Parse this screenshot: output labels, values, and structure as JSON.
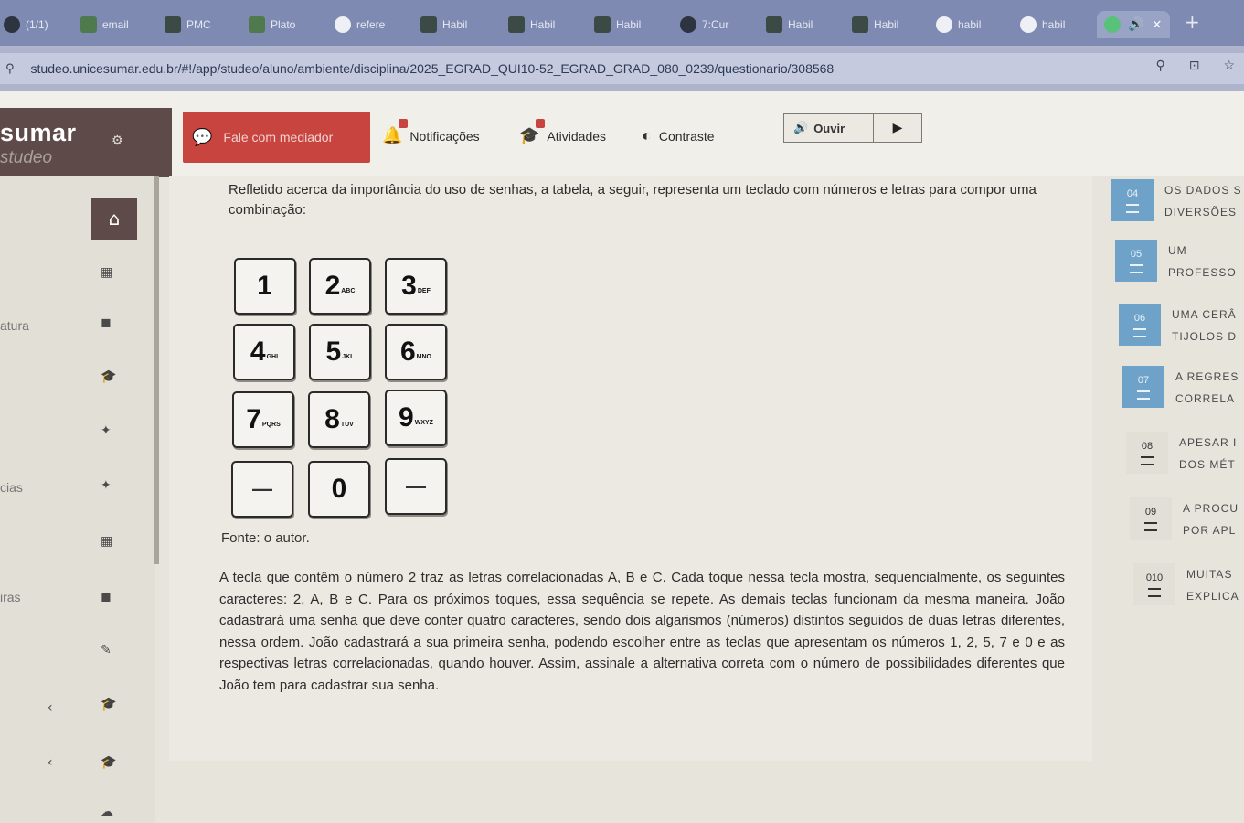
{
  "browser": {
    "tabs": [
      "(1/1)",
      "email",
      "PMC",
      "Plato",
      "refere",
      "Habil",
      "Habil",
      "Habil",
      "7:Cur",
      "Habil",
      "Habil",
      "habil",
      "habil"
    ],
    "new_tab": "+",
    "active_tab_close": "×",
    "url": "studeo.unicesumar.edu.br/#!/app/studeo/aluno/ambiente/disciplina/2025_EGRAD_QUI10-52_EGRAD_GRAD_080_0239/questionario/308568"
  },
  "header": {
    "brand_name": "sumar",
    "brand_sub": "studeo",
    "mediator_label": "Fale com mediador",
    "nav": {
      "notifications": "Notificações",
      "activities": "Atividades",
      "contrast": "Contraste"
    },
    "listen_label": "Ouvir"
  },
  "sidebar_left": {
    "labels": [
      "atura",
      "cias",
      "iras"
    ]
  },
  "question": {
    "intro": "Refletido acerca da importância do uso de senhas, a tabela, a seguir, representa um teclado com números e letras para compor uma combinação:",
    "keypad": [
      {
        "num": "1",
        "letters": ""
      },
      {
        "num": "2",
        "letters": "ABC"
      },
      {
        "num": "3",
        "letters": "DEF"
      },
      {
        "num": "4",
        "letters": "GHI"
      },
      {
        "num": "5",
        "letters": "JKL"
      },
      {
        "num": "6",
        "letters": "MNO"
      },
      {
        "num": "7",
        "letters": "PQRS"
      },
      {
        "num": "8",
        "letters": "TUV"
      },
      {
        "num": "9",
        "letters": "WXYZ"
      },
      {
        "num": "—",
        "letters": ""
      },
      {
        "num": "0",
        "letters": ""
      },
      {
        "num": "—",
        "letters": ""
      }
    ],
    "source": "Fonte: o autor.",
    "body": "A tecla que contêm o número 2 traz as letras correlacionadas A, B e C. Cada toque nessa tecla mostra, sequencialmente, os seguintes caracteres: 2, A, B e C. Para os próximos toques, essa sequência se repete. As demais teclas funcionam da mesma maneira. João cadastrará uma senha que deve conter quatro caracteres, sendo dois algarismos (números) distintos seguidos de duas letras diferentes, nessa ordem. João cadastrará a sua primeira senha, podendo escolher entre as teclas que apresentam os números 1, 2, 5, 7 e 0 e as respectivas letras correlacionadas, quando houver. Assim, assinale a alternativa correta com o número de possibilidades diferentes que João tem para cadastrar sua senha."
  },
  "question_list": [
    {
      "num": "04",
      "line1": "OS DADOS S",
      "line2": "DIVERSÕES"
    },
    {
      "num": "05",
      "line1": "UM",
      "line2": "PROFESSO"
    },
    {
      "num": "06",
      "line1": "UMA CERÂ",
      "line2": "TIJOLOS D"
    },
    {
      "num": "07",
      "line1": "A REGRES",
      "line2": "CORRELA"
    },
    {
      "num": "08",
      "line1": "APESAR I",
      "line2": "DOS MÉT"
    },
    {
      "num": "09",
      "line1": "A PROCU",
      "line2": "POR APL"
    },
    {
      "num": "010",
      "line1": "MUITAS",
      "line2": "EXPLICA"
    }
  ],
  "colors": {
    "brand": "#5e4b49",
    "mediator": "#c8453f",
    "question_badge": "#6fa2c9"
  }
}
